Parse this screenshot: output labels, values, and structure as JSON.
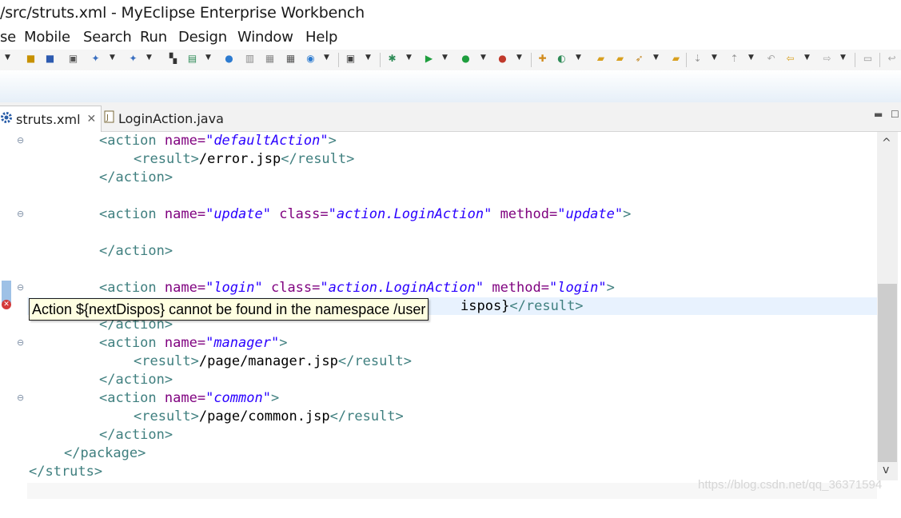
{
  "window": {
    "title": "/src/struts.xml - MyEclipse Enterprise Workbench"
  },
  "menu": {
    "items": [
      "se",
      "Mobile",
      "Search",
      "Run",
      "Design",
      "Window",
      "Help"
    ]
  },
  "tabs": [
    {
      "label": "struts.xml",
      "icon": "gear-icon",
      "active": true,
      "close": "✕"
    },
    {
      "label": "LoginAction.java",
      "icon": "java-file-icon",
      "active": false
    }
  ],
  "editor": {
    "lines": {
      "l1": {
        "open": "<action ",
        "a1": "name=",
        "v1": "\"defaultAction\"",
        "close": ">"
      },
      "l2": {
        "open": "<result>",
        "text": "/error.jsp",
        "close": "</result>"
      },
      "l3": {
        "tag": "</action>"
      },
      "l5": {
        "open": "<action ",
        "a1": "name=",
        "v1": "\"update\"",
        "a2": " class=",
        "v2": "\"action.LoginAction\"",
        "a3": " method=",
        "v3": "\"update\"",
        "close": ">"
      },
      "l7": {
        "tag": "</action>"
      },
      "l9": {
        "open": "<action ",
        "a1": "name=",
        "v1": "\"login\"",
        "a2": " class=",
        "v2": "\"action.LoginAction\"",
        "a3": " method=",
        "v3": "\"login\"",
        "close": ">"
      },
      "l10": {
        "text": "ispos}",
        "close": "</result>"
      },
      "l11": {
        "tag": "</action>"
      },
      "l12": {
        "open": "<action ",
        "a1": "name=",
        "v1": "\"manager\"",
        "close": ">"
      },
      "l13": {
        "open": "<result>",
        "text": "/page/manager.jsp",
        "close": "</result>"
      },
      "l14": {
        "tag": "</action>"
      },
      "l15": {
        "open": "<action ",
        "a1": "name=",
        "v1": "\"common\"",
        "close": ">"
      },
      "l16": {
        "open": "<result>",
        "text": "/page/common.jsp",
        "close": "</result>"
      },
      "l17": {
        "tag": "</action>"
      },
      "l18": {
        "tag": "</package>"
      },
      "l19": {
        "tag": "</struts>"
      }
    },
    "error_marker": "✕",
    "tooltip": "Action ${nextDispos} cannot be found in the namespace /user"
  },
  "scrollbar": {
    "up": "^",
    "down": "v"
  },
  "watermark": "https://blog.csdn.net/qq_36371594",
  "colors": {
    "tag": "#3f7f7f",
    "attribute": "#7f007f",
    "value": "#2a00ff",
    "tooltip_bg": "#ffffe1",
    "line_highlight": "#e8f2fe"
  }
}
